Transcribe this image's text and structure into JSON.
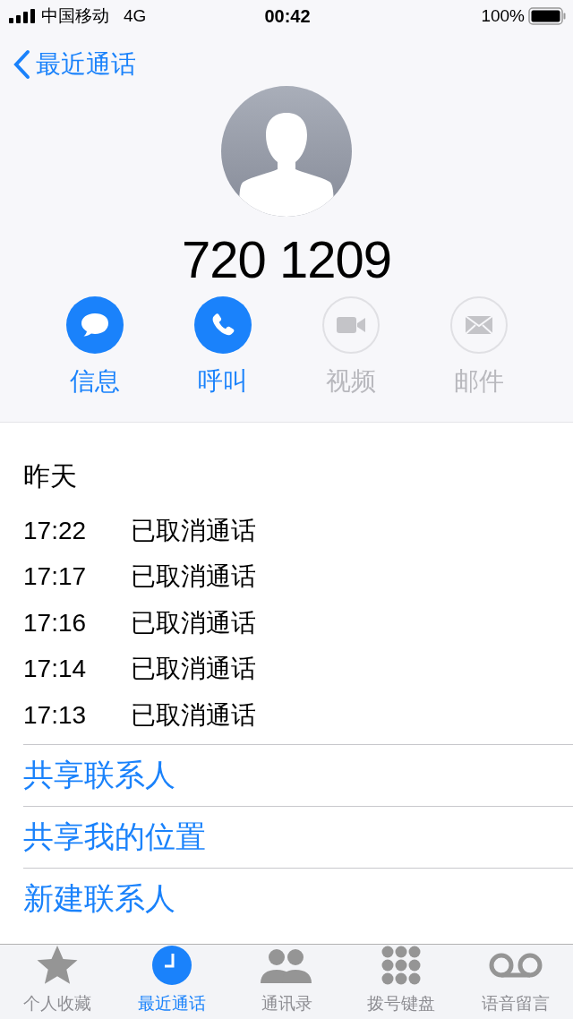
{
  "status_bar": {
    "carrier": "中国移动",
    "network": "4G",
    "time": "00:42",
    "battery": "100%"
  },
  "nav": {
    "back_label": "最近通话"
  },
  "contact": {
    "number": "720 1209"
  },
  "actions": [
    {
      "kind": "message",
      "label": "信息",
      "disabled": false
    },
    {
      "kind": "call",
      "label": "呼叫",
      "disabled": false
    },
    {
      "kind": "video",
      "label": "视频",
      "disabled": true
    },
    {
      "kind": "mail",
      "label": "邮件",
      "disabled": true
    }
  ],
  "recents": {
    "day": "昨天",
    "calls": [
      {
        "time": "17:22",
        "status": "已取消通话"
      },
      {
        "time": "17:17",
        "status": "已取消通话"
      },
      {
        "time": "17:16",
        "status": "已取消通话"
      },
      {
        "time": "17:14",
        "status": "已取消通话"
      },
      {
        "time": "17:13",
        "status": "已取消通话"
      }
    ]
  },
  "links": [
    "共享联系人",
    "共享我的位置",
    "新建联系人"
  ],
  "tab_bar": [
    {
      "kind": "favorites",
      "label": "个人收藏",
      "selected": false
    },
    {
      "kind": "recents",
      "label": "最近通话",
      "selected": true
    },
    {
      "kind": "contacts",
      "label": "通讯录",
      "selected": false
    },
    {
      "kind": "keypad",
      "label": "拨号键盘",
      "selected": false
    },
    {
      "kind": "voicemail",
      "label": "语音留言",
      "selected": false
    }
  ]
}
